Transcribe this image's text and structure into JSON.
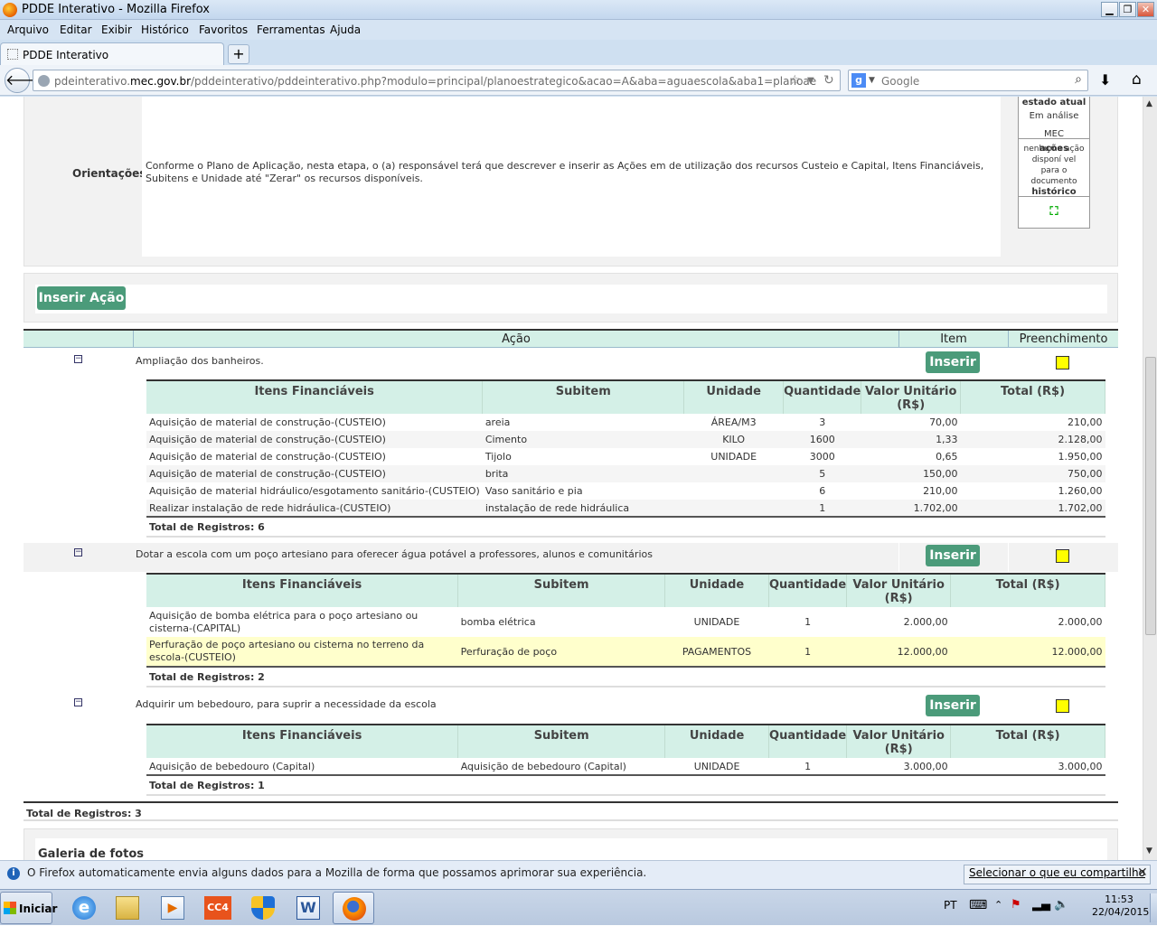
{
  "window": {
    "title": "PDDE Interativo - Mozilla Firefox"
  },
  "menu": [
    "Arquivo",
    "Editar",
    "Exibir",
    "Histórico",
    "Favoritos",
    "Ferramentas",
    "Ajuda"
  ],
  "tab": {
    "label": "PDDE Interativo",
    "new_tab": "+"
  },
  "nav": {
    "url_prefix": "pdeinterativo.",
    "url_domain": "mec.gov.br",
    "url_rest": "/pddeinterativo/pddeinterativo.php?modulo=principal/planoestrategico&acao=A&aba=aguaescola&aba1=planoae",
    "search_placeholder": "Google",
    "search_engine_letter": "g"
  },
  "orientation": {
    "label": "Orientações:",
    "text": "Conforme o Plano de Aplicação, nesta etapa, o (a) responsável terá que descrever e inserir as Ações em de utilização dos recursos Custeio e Capital, Itens Financiáveis, Subitens e Unidade até \"Zerar\" os recursos disponíveis."
  },
  "workflow": {
    "state_header": "estado atual",
    "state_value": "Em análise MEC",
    "actions_header": "ações",
    "actions_value": "nenhuma ação disponí vel para o documento",
    "history_header": "histórico"
  },
  "insert_action_label": "Inserir Ação",
  "main_headers": [
    "Ação",
    "Item",
    "Preenchimento"
  ],
  "sub_headers": [
    "Itens Financiáveis",
    "Subitem",
    "Unidade",
    "Quantidade",
    "Valor Unitário (R$)",
    "Total (R$)"
  ],
  "insert_label": "Inserir",
  "actions": [
    {
      "toggle": "−",
      "description": "Ampliação dos banheiros.",
      "rows": [
        [
          "Aquisição de material de construção-(CUSTEIO)",
          "areia",
          "ÁREA/M3",
          "3",
          "70,00",
          "210,00"
        ],
        [
          "Aquisição de material de construção-(CUSTEIO)",
          "Cimento",
          "KILO",
          "1600",
          "1,33",
          "2.128,00"
        ],
        [
          "Aquisição de material de construção-(CUSTEIO)",
          "Tijolo",
          "UNIDADE",
          "3000",
          "0,65",
          "1.950,00"
        ],
        [
          "Aquisição de material de construção-(CUSTEIO)",
          "brita",
          "",
          "5",
          "150,00",
          "750,00"
        ],
        [
          "Aquisição de material hidráulico/esgotamento sanitário-(CUSTEIO)",
          "Vaso sanitário e pia",
          "",
          "6",
          "210,00",
          "1.260,00"
        ],
        [
          "Realizar instalação de rede hidráulica-(CUSTEIO)",
          "instalação de rede hidráulica",
          "",
          "1",
          "1.702,00",
          "1.702,00"
        ]
      ],
      "total": "Total de Registros: 6"
    },
    {
      "toggle": "−",
      "description": "Dotar a escola com um poço artesiano para oferecer água potável a professores, alunos e comunitários",
      "rows": [
        [
          "Aquisição de bomba elétrica para o poço artesiano ou cisterna-(CAPITAL)",
          "bomba elétrica",
          "UNIDADE",
          "1",
          "2.000,00",
          "2.000,00"
        ],
        [
          "Perfuração de poço artesiano ou cisterna no terreno da escola-(CUSTEIO)",
          "Perfuração de poço",
          "PAGAMENTOS",
          "1",
          "12.000,00",
          "12.000,00"
        ]
      ],
      "total": "Total de Registros: 2"
    },
    {
      "toggle": "−",
      "description": "Adquirir um bebedouro, para suprir a necessidade da escola",
      "rows": [
        [
          "Aquisição de bebedouro (Capital)",
          "Aquisição de bebedouro (Capital)",
          "UNIDADE",
          "1",
          "3.000,00",
          "3.000,00"
        ]
      ],
      "total": "Total de Registros: 1"
    }
  ],
  "total_main": "Total de Registros: 3",
  "gallery_title": "Galeria de fotos",
  "notification": {
    "message": "O Firefox automaticamente envia alguns dados para a Mozilla de forma que possamos aprimorar sua experiência.",
    "button": "Selecionar o que eu compartilho",
    "close": "✕"
  },
  "taskbar": {
    "start": "Iniciar",
    "lang": "PT",
    "time": "11:53",
    "date": "22/04/2015",
    "apps": [
      "internet-explorer",
      "file-explorer",
      "media-player",
      "cc4",
      "security-shield",
      "word",
      "firefox"
    ]
  },
  "colors": {
    "accent_green": "#4b9b7a",
    "header_mint": "#d4f0e7",
    "fill_yellow": "#ffff00",
    "highlight_row": "#ffffcc"
  }
}
